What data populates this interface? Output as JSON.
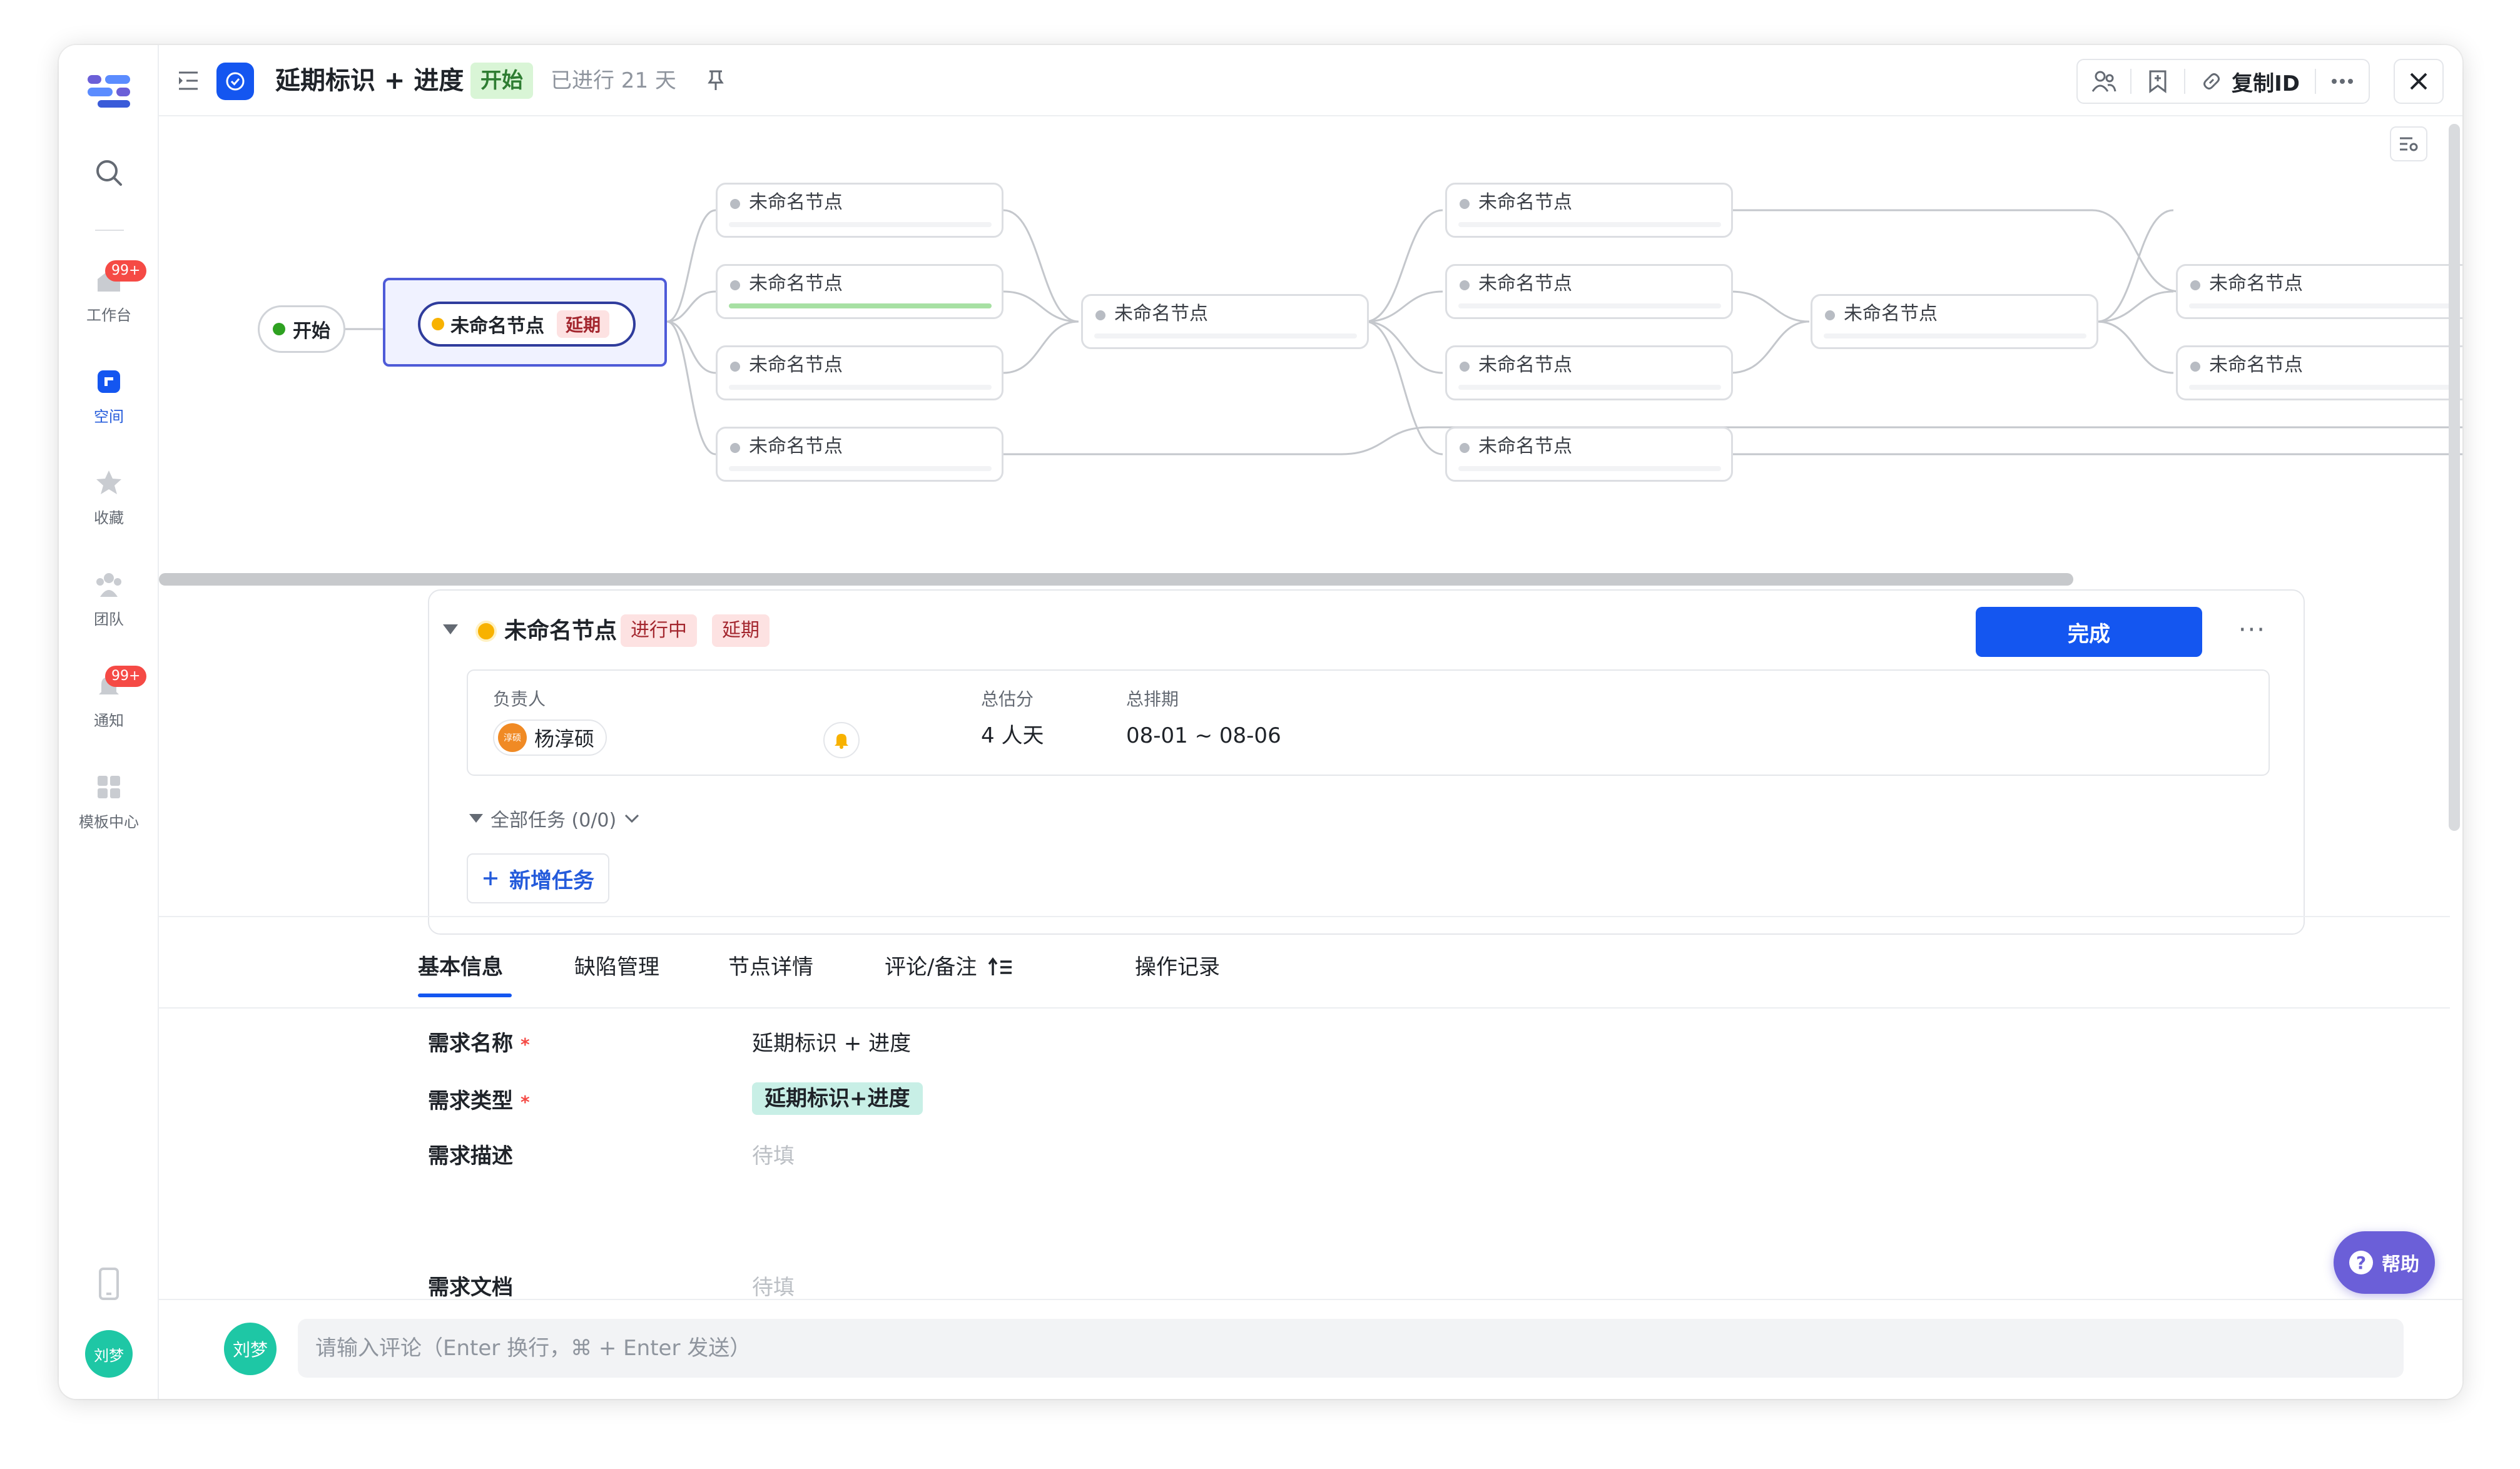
{
  "rail": {
    "items": [
      {
        "label": "工作台",
        "badge": "99+"
      },
      {
        "label": "空间"
      },
      {
        "label": "收藏"
      },
      {
        "label": "团队"
      },
      {
        "label": "通知",
        "badge": "99+"
      },
      {
        "label": "模板中心"
      }
    ],
    "user_initials": "刘梦"
  },
  "header": {
    "title": "延期标识 + 进度",
    "status": "开始",
    "elapsed": "已进行 21 天",
    "copy_id_label": "复制ID"
  },
  "flow": {
    "start_label": "开始",
    "selected_node": {
      "label": "未命名节点",
      "tag": "延期"
    },
    "node_label": "未命名节点"
  },
  "detail": {
    "name": "未命名节点",
    "tag_progress": "进行中",
    "tag_delay": "延期",
    "done_label": "完成",
    "labels": {
      "assignee": "负责人",
      "estimate": "总估分",
      "schedule": "总排期"
    },
    "assignee_name": "杨淳硕",
    "assignee_initials": "淳硕",
    "estimate": "4 人天",
    "schedule": "08-01 ~ 08-06",
    "tasks_toggle": "全部任务 (0/0)",
    "add_task": "新增任务"
  },
  "tabs": [
    "基本信息",
    "缺陷管理",
    "节点详情",
    "评论/备注",
    "操作记录"
  ],
  "form": {
    "name_label": "需求名称",
    "name_value": "延期标识 + 进度",
    "type_label": "需求类型",
    "type_value": "延期标识+进度",
    "desc_label": "需求描述",
    "desc_value": "待填",
    "doc_label": "需求文档",
    "doc_value": "待填",
    "required_mark": "*"
  },
  "help_label": "帮助",
  "comment": {
    "avatar": "刘梦",
    "placeholder": "请输入评论（Enter 换行，⌘ + Enter 发送）"
  },
  "colors": {
    "accent": "#1456f0",
    "delay_tag_bg": "#fde2e2",
    "status_green_bg": "#d9f5d6",
    "type_tag_bg": "#c8efe6",
    "help_bg": "#6b5fd8"
  }
}
